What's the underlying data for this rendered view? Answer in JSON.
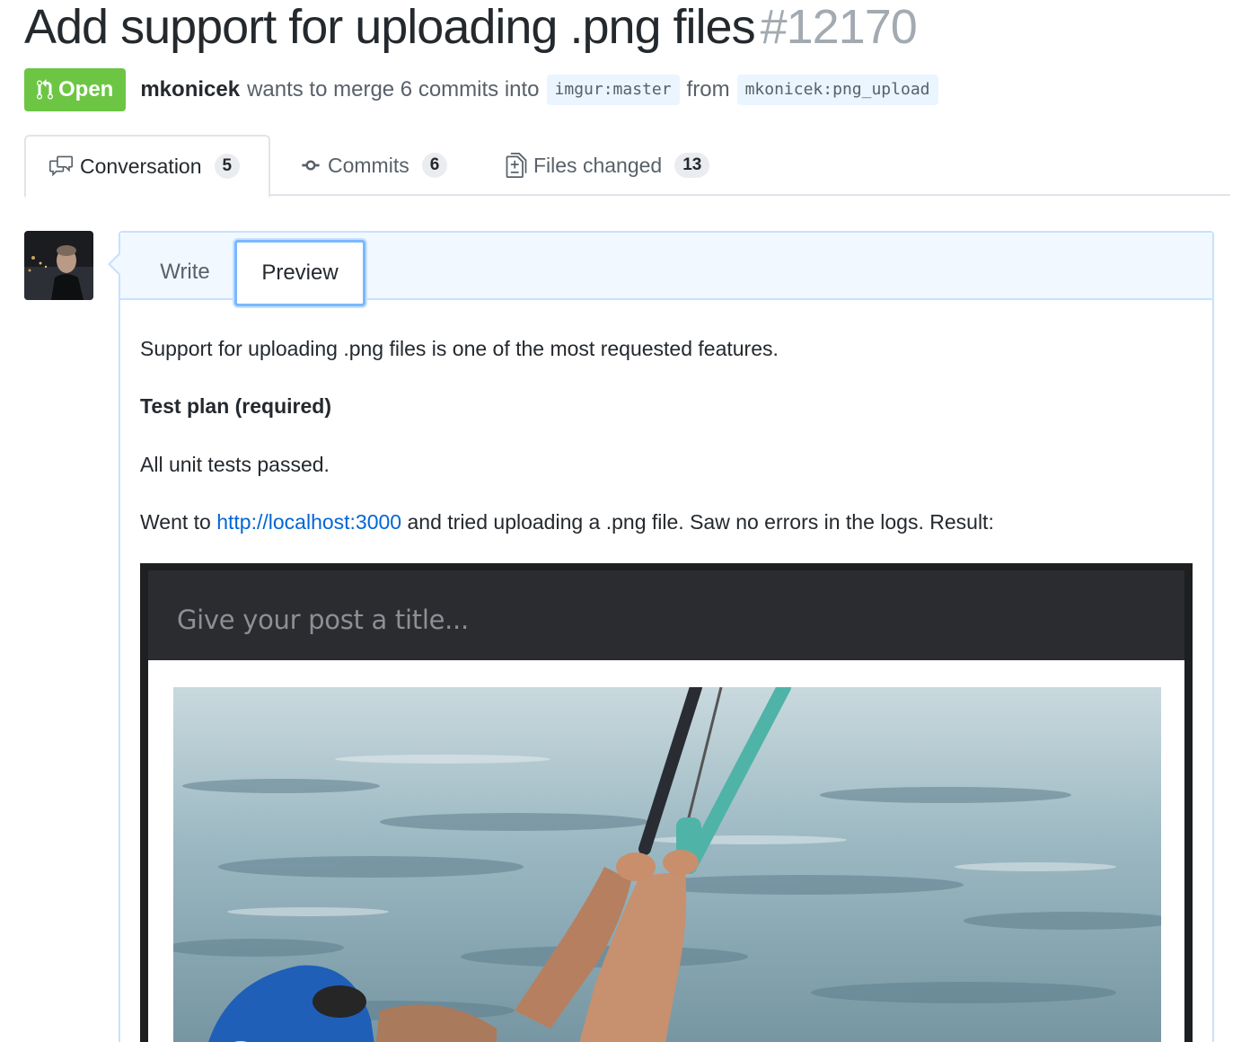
{
  "pr": {
    "title": "Add support for uploading .png files",
    "number": "#12170",
    "state": "Open",
    "author": "mkonicek",
    "merge_text": "wants to merge 6 commits into",
    "base_repo": "imgur",
    "base_branch": "master",
    "from_text": "from",
    "head_repo": "mkonicek",
    "head_branch": "png_upload"
  },
  "tabs": [
    {
      "label": "Conversation",
      "count": "5"
    },
    {
      "label": "Commits",
      "count": "6"
    },
    {
      "label": "Files changed",
      "count": "13"
    }
  ],
  "comment": {
    "write_tab": "Write",
    "preview_tab": "Preview",
    "para1": "Support for uploading .png files is one of the most requested features.",
    "para2": "Test plan (required)",
    "para3": "All unit tests passed.",
    "para4_before": "Went to",
    "para4_link": "http://localhost:3000",
    "para4_after": "and tried uploading a .png file. Saw no errors in the logs. Result:"
  },
  "screenshot": {
    "title_placeholder": "Give your post a title..."
  },
  "colors": {
    "open_green": "#6cc644",
    "link_blue": "#0366d6",
    "preview_border": "#79b8ff"
  },
  "icons": {
    "state": "git-pull-request-icon",
    "conversation": "comment-discussion-icon",
    "commits": "git-commit-icon",
    "files": "file-diff-icon"
  }
}
